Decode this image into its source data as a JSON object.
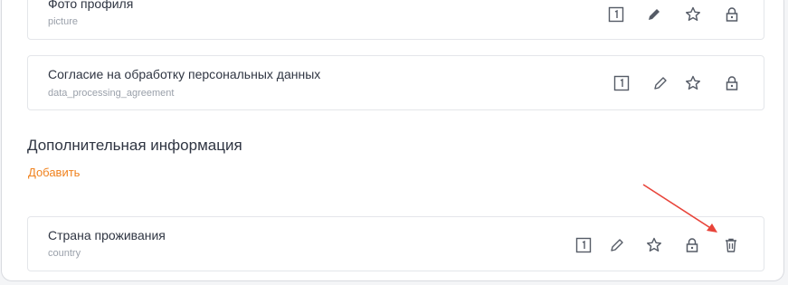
{
  "rows": [
    {
      "title": "Фото профиля",
      "subtitle": "picture"
    },
    {
      "title": "Согласие на обработку персональных данных",
      "subtitle": "data_processing_agreement"
    },
    {
      "title": "Страна проживания",
      "subtitle": "country"
    }
  ],
  "section": {
    "title": "Дополнительная информация",
    "add_label": "Добавить"
  },
  "icons": [
    "number-one-box-icon",
    "pencil-icon",
    "star-icon",
    "lock-icon",
    "trash-icon"
  ],
  "colors": {
    "accent": "#f0821e",
    "arrow": "#e8443a",
    "icon": "#555b66"
  }
}
